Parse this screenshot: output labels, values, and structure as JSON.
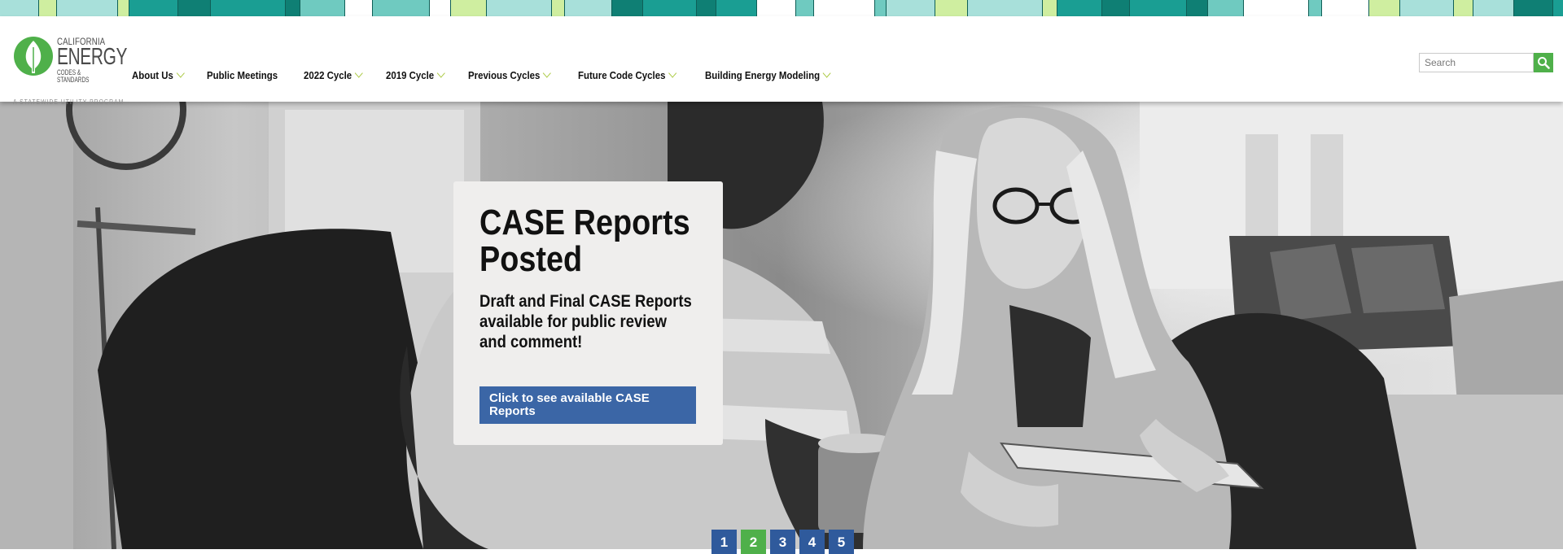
{
  "brand": {
    "line1": "CALIFORNIA",
    "line2": "ENERGY",
    "line3": "CODES & STANDARDS",
    "tagline": "A STATEWIDE UTILITY PROGRAM",
    "logo_icon": "leaf-icon",
    "green": "#4fb04a"
  },
  "nav": {
    "items": [
      {
        "label": "About Us",
        "dropdown": true
      },
      {
        "label": "Public Meetings",
        "dropdown": false
      },
      {
        "label": "2022 Cycle",
        "dropdown": true
      },
      {
        "label": "2019 Cycle",
        "dropdown": true
      },
      {
        "label": "Previous Cycles",
        "dropdown": true
      },
      {
        "label": "Future Code Cycles",
        "dropdown": true
      },
      {
        "label": "Building Energy Modeling",
        "dropdown": true
      }
    ],
    "chevron_color": "#a8c83c"
  },
  "search": {
    "placeholder": "Search",
    "value": "",
    "button_icon": "search-icon"
  },
  "hero": {
    "title": "CASE Reports Posted",
    "subtitle": "Draft and Final CASE Reports available for public review and comment!",
    "cta_label": "Click to see available CASE Reports",
    "cta_color": "#3b66a6",
    "card_bg": "#efeeed"
  },
  "pager": {
    "pages": [
      "1",
      "2",
      "3",
      "4",
      "5"
    ],
    "active": "2",
    "color": "#2f5a9c",
    "active_color": "#4fb04a"
  },
  "stripe_colors": [
    "#a8e0da",
    "#1a9e93",
    "#6fcac0",
    "#cfeea0",
    "#0f7f74",
    "#ffffff"
  ]
}
